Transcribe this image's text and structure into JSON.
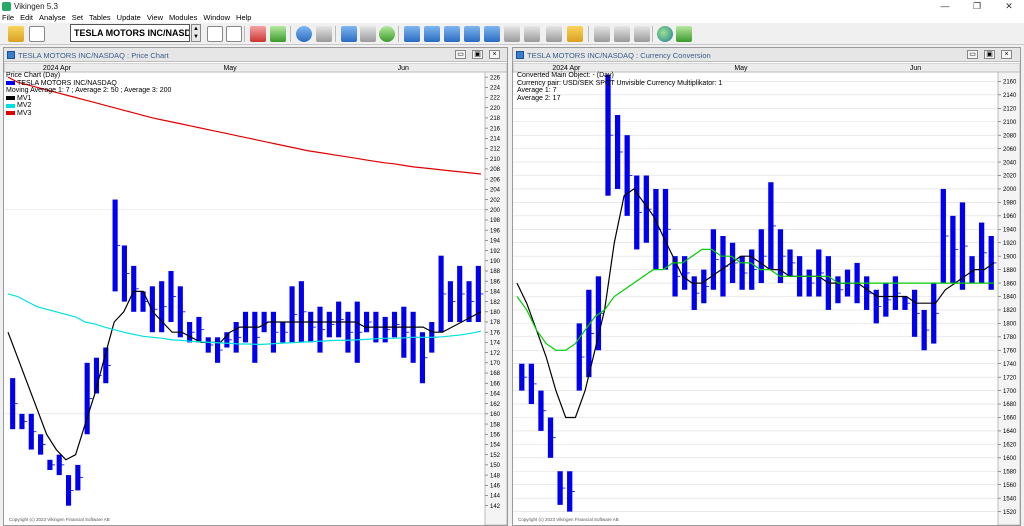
{
  "window": {
    "title": "Vikingen 5.3",
    "minimize": "—",
    "maximize": "❐",
    "close": "✕"
  },
  "menu": [
    "File",
    "Edit",
    "Analyse",
    "Set",
    "Tables",
    "Update",
    "View",
    "Modules",
    "Window",
    "Help"
  ],
  "toolbar": {
    "symbol": "TESLA MOTORS INC/NASDAQ",
    "icons": [
      "open-folder-icon",
      "open-file-icon",
      "new-document-icon",
      "settings-document-icon",
      "heartbeat-icon",
      "candles-icon",
      "refresh-icon",
      "camera-icon",
      "printer-icon",
      "print-preview-icon",
      "palette-icon",
      "layout-1-icon",
      "layout-2-icon",
      "layout-3-icon",
      "grid-icon",
      "list-icon",
      "edit-icon",
      "candlestick-icon",
      "bar-icon",
      "curve-icon",
      "globe-icon",
      "update-icon"
    ]
  },
  "price_chart": {
    "panel_title": "TESLA MOTORS INC/NASDAQ : Price Chart",
    "legend": {
      "type": "Price Chart (Day)",
      "instrument": "TESLA MOTORS INC/NASDAQ",
      "averages": "Moving Average 1: 7 ; Average 2: 50 ; Average 3: 200",
      "mv1": "MV1",
      "mv2": "MV2",
      "mv3": "MV3"
    },
    "copyright": "Copyright (c) 2023 Vikingen Financial Software AB",
    "colors": {
      "bars": "#0000ee",
      "mv1": "#000000",
      "mv2": "#00e0e0",
      "mv3": "#e00000"
    }
  },
  "currency_chart": {
    "panel_title": "TESLA MOTORS INC/NASDAQ : Currency Conversion",
    "legend": {
      "main": "Converted Main Object: - (Day)",
      "pair": "Currency pair: USD/SEK SPOT Unvisible Currency Multiplikator: 1",
      "avg1": "Average 1: 7",
      "avg2": "Average 2: 17"
    },
    "copyright": "Copyright (c) 2023 Vikingen Financial Software AB",
    "colors": {
      "bars": "#0000ee",
      "mv1": "#000000",
      "mv2": "#00cc00"
    }
  },
  "chart_data": [
    {
      "type": "bar",
      "title": "Price Chart (Day)",
      "x_labels": [
        "2024 Apr",
        "May",
        "Jun"
      ],
      "ylim": [
        139,
        227
      ],
      "yticks": [
        142,
        144,
        146,
        148,
        150,
        152,
        154,
        156,
        158,
        160,
        162,
        164,
        166,
        168,
        170,
        172,
        174,
        176,
        178,
        180,
        182,
        184,
        186,
        188,
        190,
        192,
        194,
        196,
        198,
        200,
        202,
        204,
        206,
        208,
        210,
        212,
        214,
        216,
        218,
        220,
        222,
        224,
        226
      ],
      "bars": [
        [
          157,
          167
        ],
        [
          157,
          160
        ],
        [
          153,
          160
        ],
        [
          152,
          156
        ],
        [
          149,
          151
        ],
        [
          148,
          152
        ],
        [
          142,
          148
        ],
        [
          145,
          150
        ],
        [
          156,
          170
        ],
        [
          164,
          171
        ],
        [
          166,
          173
        ],
        [
          184,
          202
        ],
        [
          182,
          193
        ],
        [
          180,
          189
        ],
        [
          180,
          184
        ],
        [
          176,
          185
        ],
        [
          176,
          186
        ],
        [
          178,
          188
        ],
        [
          175,
          185
        ],
        [
          174,
          178
        ],
        [
          174,
          179
        ],
        [
          172,
          175
        ],
        [
          170,
          175
        ],
        [
          173,
          176
        ],
        [
          172,
          178
        ],
        [
          174,
          180
        ],
        [
          170,
          180
        ],
        [
          176,
          180
        ],
        [
          172,
          180
        ],
        [
          174,
          178
        ],
        [
          174,
          185
        ],
        [
          174,
          186
        ],
        [
          174,
          180
        ],
        [
          172,
          181
        ],
        [
          175,
          180
        ],
        [
          175,
          182
        ],
        [
          172,
          180
        ],
        [
          170,
          182
        ],
        [
          176,
          180
        ],
        [
          174,
          180
        ],
        [
          174,
          179
        ],
        [
          175,
          180
        ],
        [
          171,
          181
        ],
        [
          170,
          180
        ],
        [
          166,
          176
        ],
        [
          172,
          178
        ],
        [
          176,
          191
        ],
        [
          178,
          186
        ],
        [
          178,
          189
        ],
        [
          178,
          186
        ],
        [
          178,
          189
        ]
      ],
      "series": [
        {
          "name": "MV1",
          "values": [
            176,
            171,
            166,
            161,
            156,
            153,
            151,
            152,
            158,
            164,
            171,
            178,
            180,
            184,
            184,
            180,
            178,
            176,
            176,
            175,
            174,
            174,
            174,
            176,
            177,
            177,
            177,
            178,
            178,
            178,
            178,
            178,
            178,
            178,
            178,
            178,
            178,
            177,
            177,
            177,
            177,
            177,
            177,
            177,
            176,
            176,
            177,
            178,
            179,
            180
          ]
        },
        {
          "name": "MV2",
          "values": [
            183.5,
            183,
            182,
            181,
            180.5,
            180,
            179.5,
            179,
            178,
            177.6,
            177,
            176.5,
            176,
            175.6,
            175.2,
            175,
            174.8,
            174.5,
            174.4,
            174.2,
            174.1,
            174.0,
            173.9,
            173.8,
            173.7,
            173.7,
            173.6,
            173.7,
            173.8,
            173.9,
            174,
            174.1,
            174.2,
            174.3,
            174.4,
            174.4,
            174.5,
            174.6,
            174.7,
            174.8,
            174.8,
            174.9,
            175,
            175,
            175,
            175.1,
            175.3,
            175.5,
            175.8,
            176.2
          ]
        },
        {
          "name": "MV3",
          "values": [
            226,
            225,
            224.5,
            224,
            223.5,
            223,
            222.5,
            222,
            221.5,
            221,
            220.5,
            220,
            219.5,
            219,
            218.5,
            218,
            217.6,
            217.2,
            216.8,
            216.4,
            216,
            215.6,
            215.2,
            214.8,
            214.4,
            214,
            213.6,
            213.2,
            212.8,
            212.4,
            212,
            211.6,
            211.3,
            211,
            210.7,
            210.4,
            210.1,
            209.8,
            209.5,
            209.2,
            209,
            208.7,
            208.4,
            208.2,
            208,
            207.8,
            207.6,
            207.4,
            207.2,
            207
          ]
        }
      ]
    },
    {
      "type": "bar",
      "title": "Currency Conversion (Day)",
      "x_labels": [
        "2024 Apr",
        "May",
        "Jun"
      ],
      "ylim": [
        1506,
        2174
      ],
      "yticks": [
        1520,
        1540,
        1560,
        1580,
        1600,
        1620,
        1640,
        1660,
        1680,
        1700,
        1720,
        1740,
        1760,
        1780,
        1800,
        1820,
        1840,
        1860,
        1880,
        1900,
        1920,
        1940,
        1960,
        1980,
        2000,
        2020,
        2040,
        2060,
        2080,
        2100,
        2120,
        2140,
        2160
      ],
      "bars": [
        [
          1700,
          1740
        ],
        [
          1680,
          1740
        ],
        [
          1640,
          1700
        ],
        [
          1600,
          1660
        ],
        [
          1530,
          1580
        ],
        [
          1520,
          1580
        ],
        [
          1700,
          1800
        ],
        [
          1720,
          1850
        ],
        [
          1760,
          1870
        ],
        [
          1990,
          2170
        ],
        [
          2000,
          2110
        ],
        [
          1960,
          2080
        ],
        [
          1910,
          2020
        ],
        [
          1920,
          2020
        ],
        [
          1880,
          2000
        ],
        [
          1880,
          2000
        ],
        [
          1840,
          1900
        ],
        [
          1850,
          1900
        ],
        [
          1820,
          1870
        ],
        [
          1830,
          1880
        ],
        [
          1850,
          1940
        ],
        [
          1840,
          1930
        ],
        [
          1860,
          1920
        ],
        [
          1850,
          1900
        ],
        [
          1850,
          1910
        ],
        [
          1860,
          1940
        ],
        [
          1880,
          2010
        ],
        [
          1860,
          1940
        ],
        [
          1870,
          1910
        ],
        [
          1840,
          1900
        ],
        [
          1840,
          1880
        ],
        [
          1840,
          1910
        ],
        [
          1820,
          1900
        ],
        [
          1830,
          1870
        ],
        [
          1840,
          1880
        ],
        [
          1830,
          1890
        ],
        [
          1820,
          1870
        ],
        [
          1800,
          1850
        ],
        [
          1810,
          1860
        ],
        [
          1820,
          1870
        ],
        [
          1820,
          1840
        ],
        [
          1780,
          1850
        ],
        [
          1760,
          1820
        ],
        [
          1770,
          1860
        ],
        [
          1860,
          2000
        ],
        [
          1860,
          1960
        ],
        [
          1850,
          1980
        ],
        [
          1860,
          1900
        ],
        [
          1860,
          1950
        ],
        [
          1850,
          1930
        ]
      ],
      "series": [
        {
          "name": "Average 1",
          "values": [
            1860,
            1830,
            1790,
            1750,
            1700,
            1660,
            1660,
            1700,
            1760,
            1820,
            1920,
            1990,
            2000,
            1980,
            1960,
            1930,
            1900,
            1870,
            1860,
            1860,
            1870,
            1880,
            1890,
            1900,
            1900,
            1890,
            1880,
            1880,
            1870,
            1870,
            1870,
            1870,
            1860,
            1860,
            1860,
            1860,
            1850,
            1840,
            1840,
            1840,
            1840,
            1830,
            1830,
            1830,
            1850,
            1860,
            1870,
            1880,
            1880,
            1890
          ]
        },
        {
          "name": "Average 2",
          "values": [
            1840,
            1820,
            1790,
            1770,
            1760,
            1760,
            1770,
            1790,
            1810,
            1820,
            1840,
            1850,
            1860,
            1870,
            1880,
            1880,
            1890,
            1890,
            1900,
            1910,
            1910,
            1900,
            1900,
            1890,
            1890,
            1880,
            1880,
            1870,
            1870,
            1870,
            1870,
            1870,
            1870,
            1860,
            1860,
            1860,
            1860,
            1860,
            1860,
            1860,
            1860,
            1860,
            1860,
            1860,
            1860,
            1860,
            1860,
            1860,
            1860,
            1860
          ]
        }
      ]
    }
  ]
}
